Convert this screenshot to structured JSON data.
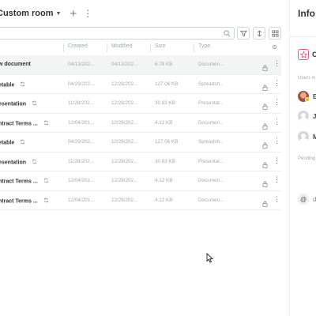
{
  "room": {
    "title": "Custom room"
  },
  "search": {
    "placeholder": ""
  },
  "columns": {
    "name": "",
    "created": "Created",
    "modified": "Modified",
    "size": "Size",
    "type": "Type"
  },
  "files": [
    {
      "name": "w document",
      "created": "04/13/202...",
      "modified": "04/13/202...",
      "size": "6.78 KB",
      "type": "Documen...",
      "sync": false,
      "selected": true
    },
    {
      "name": "etable",
      "created": "04/29/202...",
      "modified": "12/28/202...",
      "size": "127.06 KB",
      "type": "Spreadsh...",
      "sync": true,
      "selected": false
    },
    {
      "name": "esentation",
      "created": "11/28/202...",
      "modified": "12/28/202...",
      "size": "30.83 KB",
      "type": "Presentat...",
      "sync": true,
      "selected": false
    },
    {
      "name": "ntract Terms ...",
      "created": "12/04/201...",
      "modified": "12/28/202...",
      "size": "4.12 KB",
      "type": "Documen...",
      "sync": true,
      "selected": false
    },
    {
      "name": "etable",
      "created": "04/29/202...",
      "modified": "12/28/202...",
      "size": "127.06 KB",
      "type": "Spreadsh...",
      "sync": true,
      "selected": false
    },
    {
      "name": "esentation",
      "created": "11/28/202...",
      "modified": "12/28/202...",
      "size": "30.83 KB",
      "type": "Presentat...",
      "sync": true,
      "selected": false
    },
    {
      "name": "ntract Terms ...",
      "created": "12/04/201...",
      "modified": "12/28/202...",
      "size": "4.12 KB",
      "type": "Documen...",
      "sync": true,
      "selected": false
    },
    {
      "name": "ntract Terms ...",
      "created": "12/04/201...",
      "modified": "12/28/202...",
      "size": "4.12 KB",
      "type": "Documen...",
      "sync": true,
      "selected": false
    }
  ],
  "info": {
    "title": "Info",
    "room_letter": "C",
    "users_label": "Users in",
    "members": [
      {
        "letter": "E",
        "avatar": "photo-avatar",
        "online_badge_color": "#f2b500"
      },
      {
        "letter": "Je",
        "avatar": "default-avatar"
      },
      {
        "letter": "M",
        "avatar": "default-avatar"
      }
    ],
    "pending_label": "Pending",
    "pending_letter": "d"
  },
  "colors": {
    "accent": "#e05a80",
    "selected_row": "#f3f4f4",
    "muted_text": "#a3a9ae",
    "border": "#d0d5da"
  },
  "icons": [
    "caret-down-icon",
    "plus-icon",
    "vertical-dots-icon",
    "search-icon",
    "filter-icon",
    "sort-icon",
    "grid-view-icon",
    "settings-icon",
    "sync-icon",
    "lock-icon",
    "more-icon",
    "star-icon",
    "at-icon",
    "mouse-cursor-icon"
  ]
}
